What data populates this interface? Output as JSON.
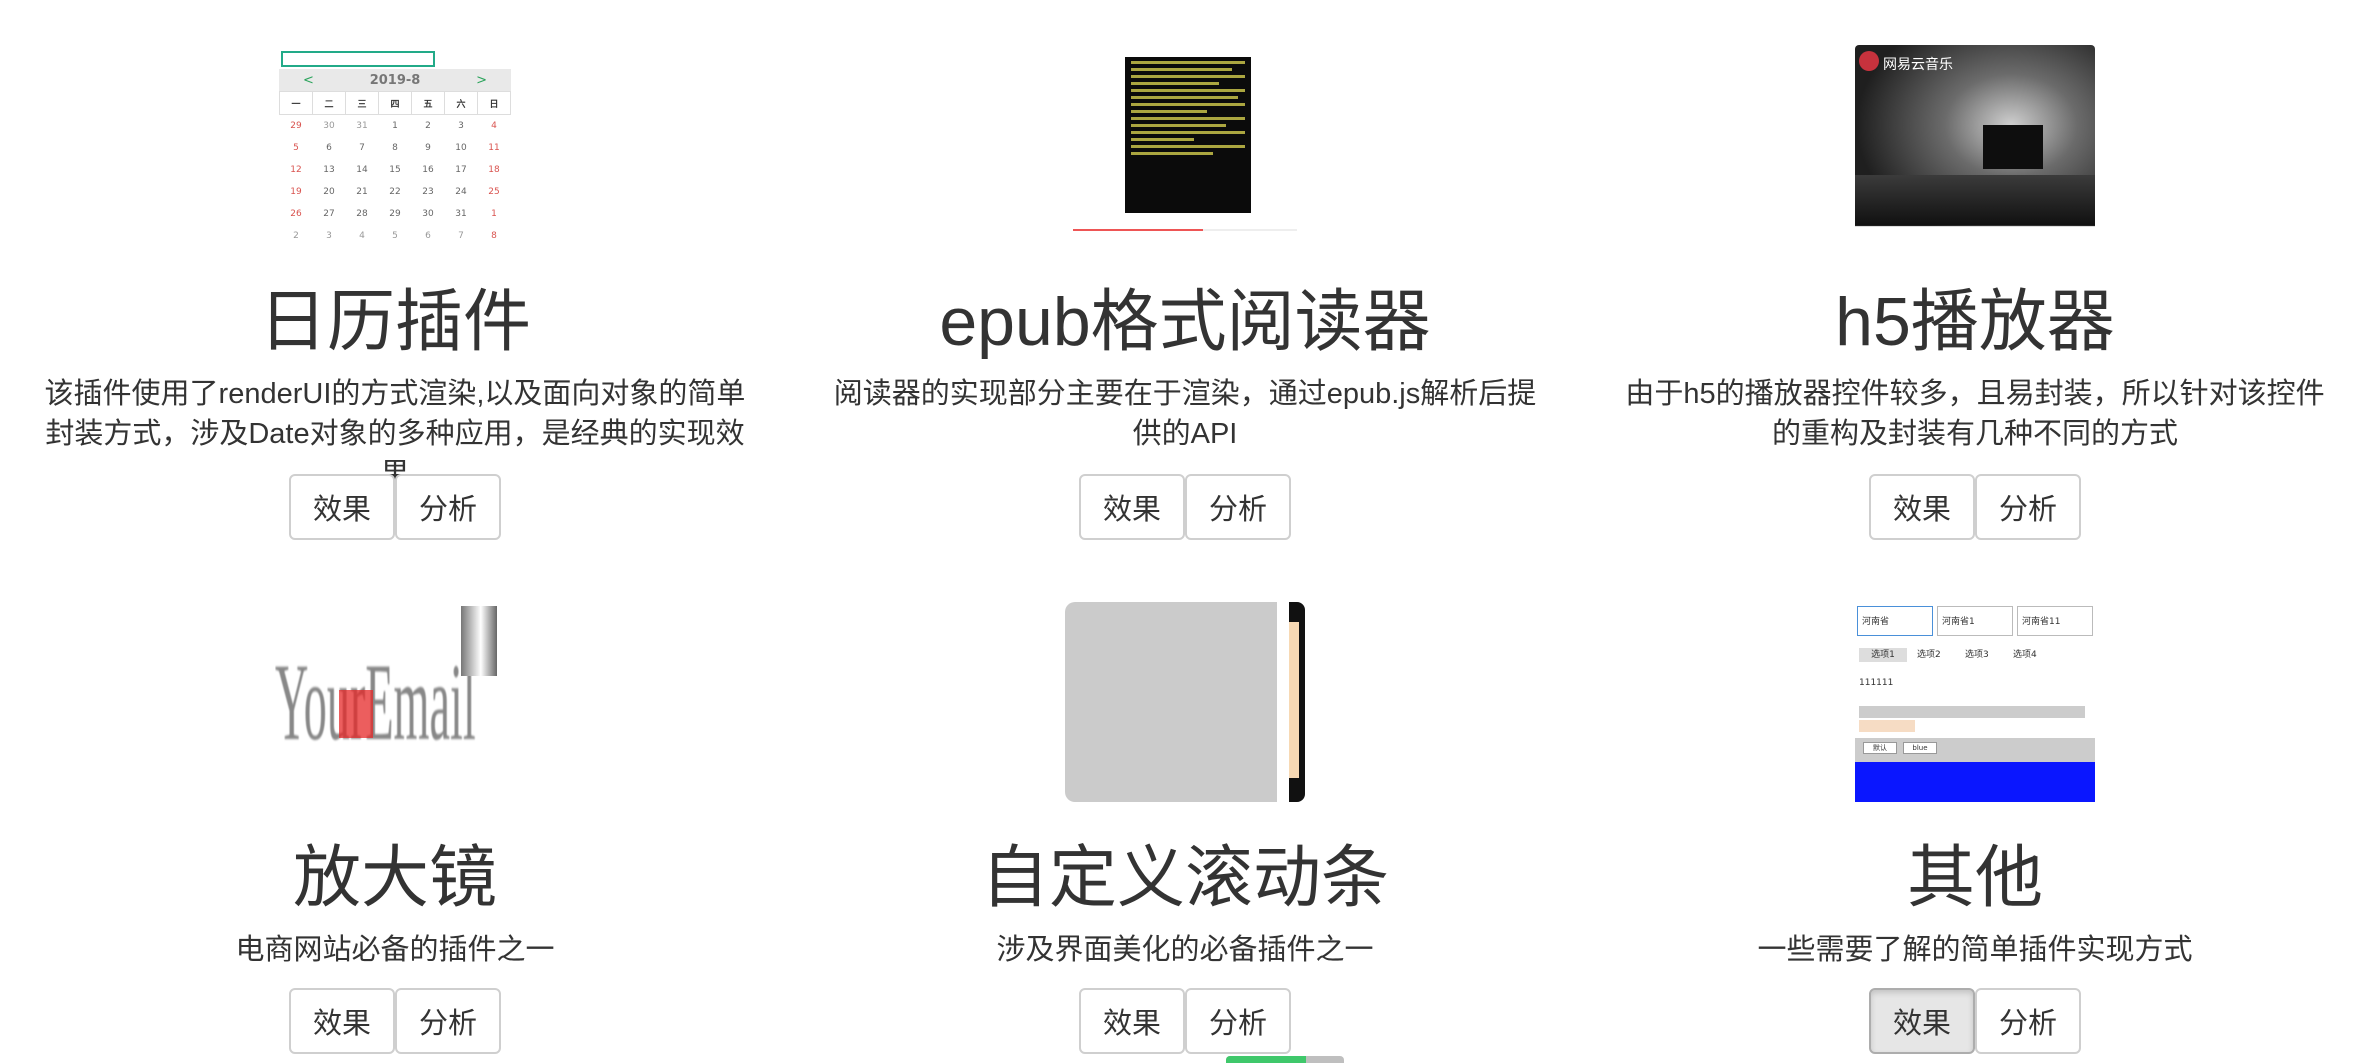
{
  "plugins": [
    {
      "id": "calendar",
      "title": "日历插件",
      "desc": "该插件使用了renderUI的方式渲染,以及面向对象的简单封装方式，涉及Date对象的多种应用，是经典的实现效果",
      "btn_effect": "效果",
      "btn_analysis": "分析",
      "preview": {
        "month": "2019-8",
        "prev": "<",
        "next": ">",
        "weekdays": [
          "一",
          "二",
          "三",
          "四",
          "五",
          "六",
          "日"
        ],
        "rows": [
          [
            "29",
            "30",
            "31",
            "1",
            "2",
            "3",
            "4"
          ],
          [
            "5",
            "6",
            "7",
            "8",
            "9",
            "10",
            "11"
          ],
          [
            "12",
            "13",
            "14",
            "15",
            "16",
            "17",
            "18"
          ],
          [
            "19",
            "20",
            "21",
            "22",
            "23",
            "24",
            "25"
          ],
          [
            "26",
            "27",
            "28",
            "29",
            "30",
            "31",
            "1"
          ],
          [
            "2",
            "3",
            "4",
            "5",
            "6",
            "7",
            "8"
          ]
        ]
      }
    },
    {
      "id": "epub",
      "title": "epub格式阅读器",
      "desc": "阅读器的实现部分主要在于渲染，通过epub.js解析后提供的API",
      "btn_effect": "效果",
      "btn_analysis": "分析"
    },
    {
      "id": "h5player",
      "title": "h5播放器",
      "desc": "由于h5的播放器控件较多，且易封装，所以针对该控件的重构及封装有几种不同的方式",
      "btn_effect": "效果",
      "btn_analysis": "分析",
      "preview": {
        "logo_text": "网易云音乐"
      }
    },
    {
      "id": "magnifier",
      "title": "放大镜",
      "desc": "电商网站必备的插件之一",
      "btn_effect": "效果",
      "btn_analysis": "分析",
      "preview": {
        "text": "YourEmail"
      }
    },
    {
      "id": "scrollbar",
      "title": "自定义滚动条",
      "desc": "涉及界面美化的必备插件之一",
      "btn_effect": "效果",
      "btn_analysis": "分析"
    },
    {
      "id": "other",
      "title": "其他",
      "desc": "一些需要了解的简单插件实现方式",
      "btn_effect": "效果",
      "btn_analysis": "分析",
      "preview": {
        "selects": [
          "河南省",
          "河南省1",
          "河南省11"
        ],
        "tabs": [
          "选项1",
          "选项2",
          "选项3",
          "选项4"
        ],
        "value": "111111",
        "inputs": [
          "默认",
          "blue"
        ]
      }
    }
  ],
  "colors": {
    "text": "#333333",
    "button_border": "#cfcfcf",
    "pressed_button_bg": "#e6e6e6",
    "calendar_accent": "#29a35a",
    "weekend": "#d9534f",
    "blue_panel": "#0a16ff",
    "scroll_green": "#3fc86b"
  }
}
